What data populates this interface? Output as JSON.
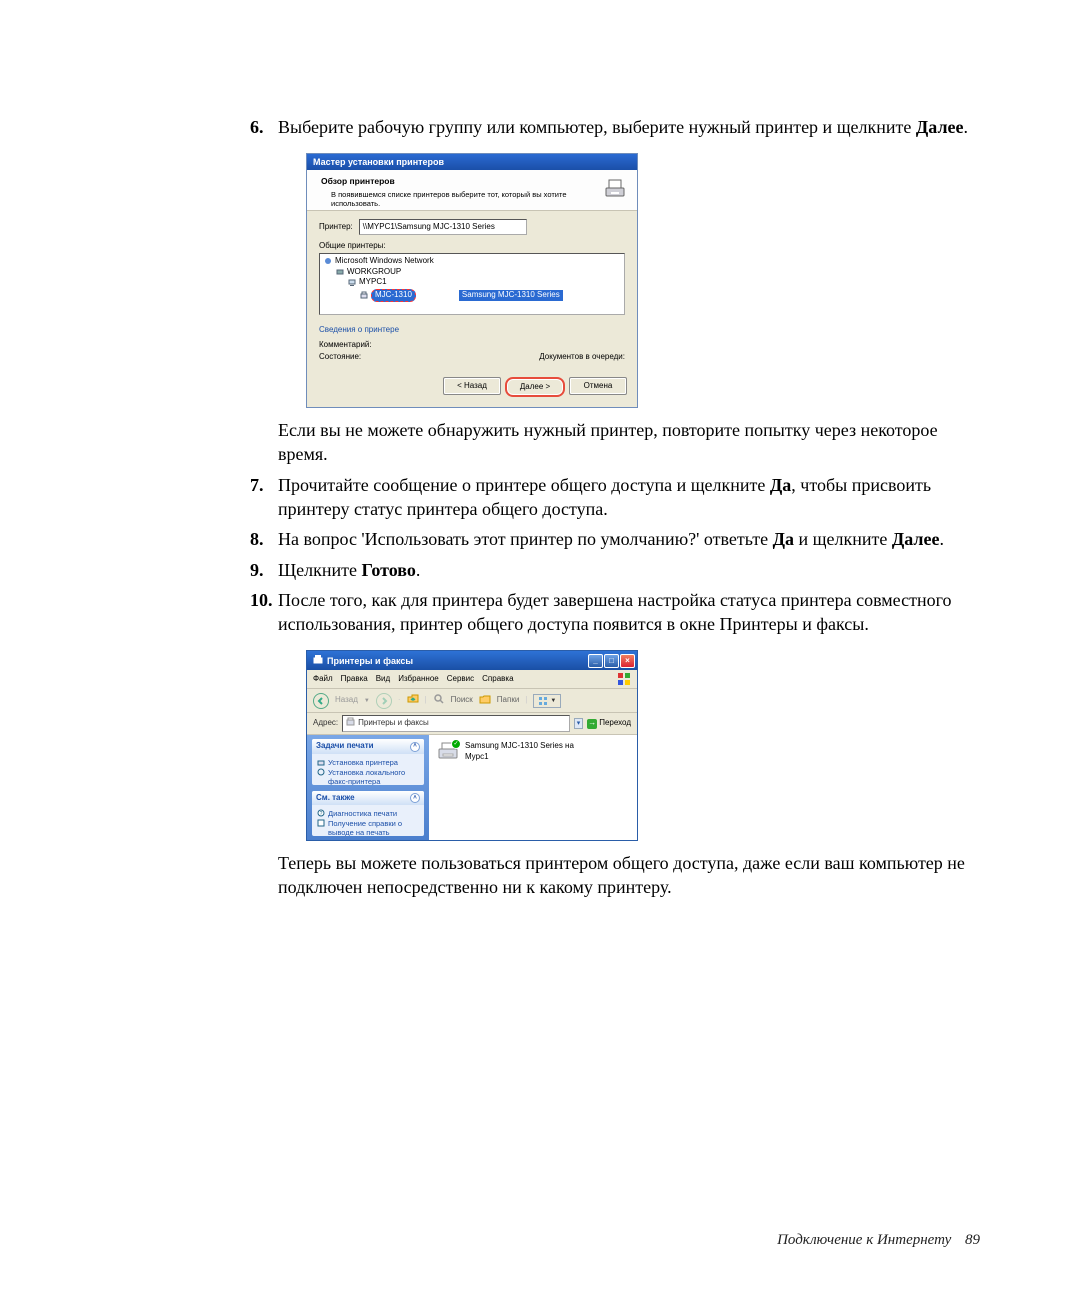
{
  "steps": {
    "s6a": "Выберите рабочую группу или компьютер, выберите нужный принтер и щелкните ",
    "s6b": "Далее",
    "s6_note": "Если вы не можете обнаружить нужный принтер, повторите попытку через некоторое время.",
    "s7a": "Прочитайте сообщение о принтере общего доступа и щелкните ",
    "s7b": "Да",
    "s7c": ", чтобы присвоить принтеру статус принтера общего доступа.",
    "s8a": "На вопрос 'Использовать этот принтер по умолчанию?' ответьте ",
    "s8b": "Да",
    "s8c": " и щелкните ",
    "s8d": "Далее",
    "s9a": "Щелкните ",
    "s9b": "Готово",
    "s10": "После того, как для принтера будет завершена настройка статуса принтера совместного использования, принтер общего доступа появится в окне Принтеры и факсы.",
    "after": "Теперь вы можете пользоваться принтером общего доступа, даже если ваш компьютер не подключен непосредственно ни к какому принтеру."
  },
  "wizard": {
    "title": "Мастер установки принтеров",
    "heading": "Обзор принтеров",
    "subheading": "В появившемся списке принтеров выберите тот, который вы хотите использовать.",
    "printer_label": "Принтер:",
    "printer_value": "\\\\MYPC1\\Samsung MJC-1310 Series",
    "shared_label": "Общие принтеры:",
    "tree": {
      "l1": "Microsoft Windows Network",
      "l2": "WORKGROUP",
      "l3": "MYPC1",
      "sel_name": "MJC-1310",
      "sel_desc": "Samsung MJC-1310 Series"
    },
    "info_title": "Сведения о принтере",
    "comment_label": "Комментарий:",
    "status_label": "Состояние:",
    "docs_label": "Документов в очереди:",
    "btn_back": "< Назад",
    "btn_next": "Далее >",
    "btn_cancel": "Отмена"
  },
  "explorer": {
    "title": "Принтеры и факсы",
    "menu": {
      "file": "Файл",
      "edit": "Правка",
      "view": "Вид",
      "fav": "Избранное",
      "tools": "Сервис",
      "help": "Справка"
    },
    "toolbar": {
      "back": "Назад",
      "search": "Поиск",
      "folders": "Папки"
    },
    "address_label": "Адрес:",
    "address_text": "Принтеры и факсы",
    "go": "Переход",
    "panel1_title": "Задачи печати",
    "panel1_task1": "Установка принтера",
    "panel1_task2": "Установка локального факс-принтера",
    "panel2_title": "См. также",
    "panel2_task1": "Диагностика печати",
    "panel2_task2": "Получение справки о выводе на печать",
    "printer_name": "Samsung MJC-1310 Series на Mypc1"
  },
  "footer": {
    "text": "Подключение к Интернету",
    "page": "89"
  }
}
